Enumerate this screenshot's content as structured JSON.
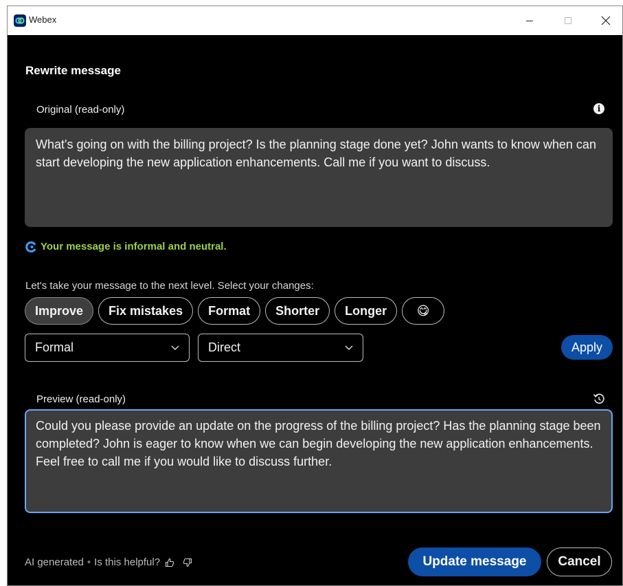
{
  "window": {
    "title": "Webex"
  },
  "dialog": {
    "heading": "Rewrite message",
    "original": {
      "label": "Original (read-only)",
      "text": "What's going on with the billing project? Is the planning stage done yet? John wants to know when can start developing the new application enhancements. Call me if you want to discuss."
    },
    "tone_status": "Your message is informal and neutral.",
    "prompt": "Let's take your message to the next level. Select your changes:",
    "chips": [
      {
        "label": "Improve",
        "active": true
      },
      {
        "label": "Fix mistakes",
        "active": false
      },
      {
        "label": "Format",
        "active": false
      },
      {
        "label": "Shorter",
        "active": false
      },
      {
        "label": "Longer",
        "active": false
      },
      {
        "label": "😋",
        "active": false
      }
    ],
    "tone_select": {
      "value": "Formal"
    },
    "style_select": {
      "value": "Direct"
    },
    "apply_label": "Apply",
    "preview": {
      "label": "Preview (read-only)",
      "text": "Could you please provide an update on the progress of the billing project? Has the planning stage been completed? John is eager to know when we can begin developing the new application enhancements. Feel free to call me if you would like to discuss further."
    },
    "footer": {
      "ai_label": "AI generated",
      "separator": "•",
      "helpful_question": "Is this helpful?"
    },
    "update_label": "Update message",
    "cancel_label": "Cancel"
  },
  "colors": {
    "background": "#000000",
    "accent": "#0d4ea6",
    "tone_green": "#9ed04b",
    "focus_border": "#6aa6f6"
  },
  "icons": [
    "webex-logo-icon",
    "minimize-icon",
    "maximize-icon",
    "close-icon",
    "info-icon",
    "ai-assistant-icon",
    "chevron-down-icon",
    "reset-icon",
    "thumbs-up-icon",
    "thumbs-down-icon"
  ]
}
